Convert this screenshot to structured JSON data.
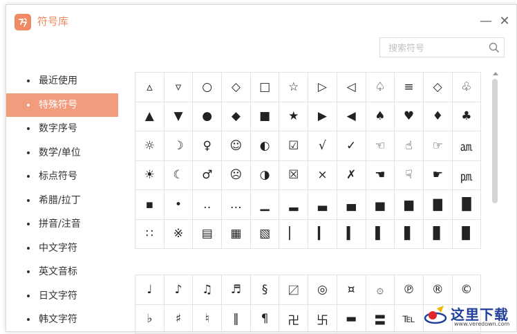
{
  "window": {
    "title": "符号库"
  },
  "controls": {
    "minimize": "—",
    "close": "✕"
  },
  "search": {
    "placeholder": "搜索符号",
    "value": ""
  },
  "sidebar": {
    "items": [
      {
        "label": "最近使用",
        "active": false
      },
      {
        "label": "特殊符号",
        "active": true
      },
      {
        "label": "数字序号",
        "active": false
      },
      {
        "label": "数学/单位",
        "active": false
      },
      {
        "label": "标点符号",
        "active": false
      },
      {
        "label": "希腊/拉丁",
        "active": false
      },
      {
        "label": "拼音/注音",
        "active": false
      },
      {
        "label": "中文字符",
        "active": false
      },
      {
        "label": "英文音标",
        "active": false
      },
      {
        "label": "日文字符",
        "active": false
      },
      {
        "label": "韩文字符",
        "active": false
      }
    ]
  },
  "symbols_group1": [
    "▵",
    "▿",
    "○",
    "◇",
    "□",
    "☆",
    "▷",
    "◁",
    "♤",
    "≡",
    "◇",
    "♧",
    "▲",
    "▼",
    "●",
    "◆",
    "■",
    "★",
    "▶",
    "◀",
    "♠",
    "♥",
    "♦",
    "♣",
    "☼",
    "☽",
    "♀",
    "☺",
    "◐",
    "☑",
    "√",
    "✓",
    "☜",
    "☝",
    "☞",
    "㏂",
    "☀",
    "☾",
    "♂",
    "☹",
    "◑",
    "☒",
    "×",
    "✗",
    "☚",
    "☟",
    "☛",
    "㏘",
    "▪",
    "•",
    "‥",
    "…",
    "▁",
    "▂",
    "▃",
    "▄",
    "▅",
    "▆",
    "▇",
    "█",
    "∷",
    "※",
    "▤",
    "▦",
    "▧",
    "▏",
    "▎",
    "▍",
    "▌",
    "▋",
    "▊",
    "▉"
  ],
  "symbols_group2": [
    "♩",
    "♪",
    "♫",
    "♬",
    "§",
    "〼",
    "◎",
    "¤",
    "۞",
    "℗",
    "®",
    "©",
    "♭",
    "♯",
    "♮",
    "‖",
    "¶",
    "卍",
    "卐",
    "▬",
    "〓",
    "℡",
    "",
    ""
  ],
  "watermark": {
    "brand": "这里下载",
    "url": "www.veredown.com"
  },
  "colors": {
    "accent": "#f08a62",
    "active_bg": "#f29b7d",
    "watermark": "#1f3f99"
  }
}
